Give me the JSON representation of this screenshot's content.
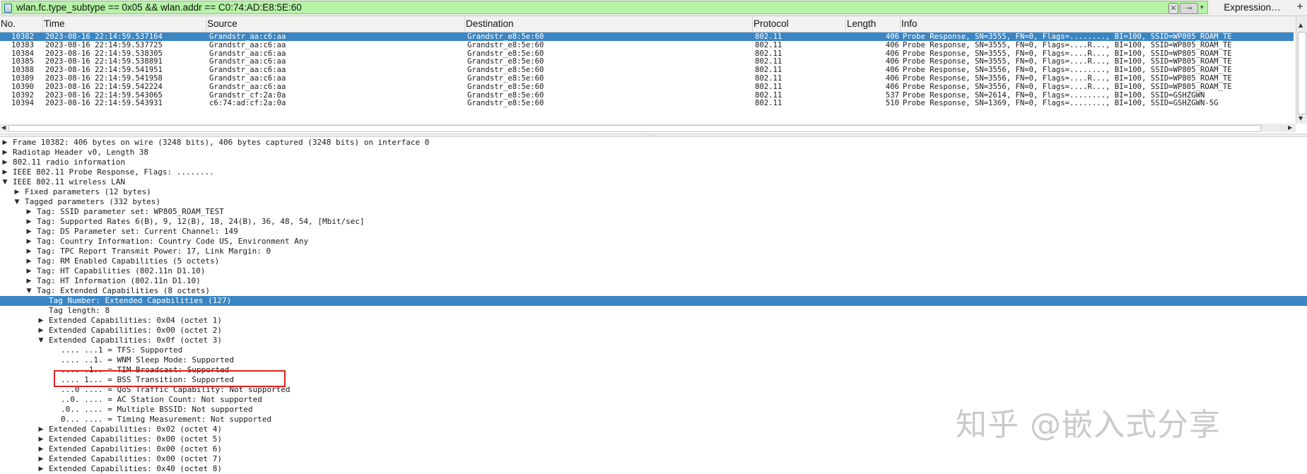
{
  "filter": {
    "expression": "wlan.fc.type_subtype == 0x05 && wlan.addr == C0:74:AD:E8:5E:60",
    "expression_button": "Expression…",
    "add_button": "+",
    "clear_glyph": "✕",
    "apply_glyph": "→",
    "history_glyph": "▾"
  },
  "packet_list": {
    "columns": [
      "No.",
      "Time",
      "Source",
      "Destination",
      "Protocol",
      "Length",
      "Info"
    ],
    "selected_color": "#3a86c4",
    "rows": [
      {
        "no": "10382",
        "time": "2023-08-16 22:14:59.537164",
        "source": "Grandstr_aa:c6:aa",
        "destination": "Grandstr_e8:5e:60",
        "protocol": "802.11",
        "length": "406",
        "info": "Probe Response, SN=3555, FN=0, Flags=........, BI=100, SSID=WP805_ROAM_TE"
      },
      {
        "no": "10383",
        "time": "2023-08-16 22:14:59.537725",
        "source": "Grandstr_aa:c6:aa",
        "destination": "Grandstr_e8:5e:60",
        "protocol": "802.11",
        "length": "406",
        "info": "Probe Response, SN=3555, FN=0, Flags=....R..., BI=100, SSID=WP805_ROAM_TE"
      },
      {
        "no": "10384",
        "time": "2023-08-16 22:14:59.538305",
        "source": "Grandstr_aa:c6:aa",
        "destination": "Grandstr_e8:5e:60",
        "protocol": "802.11",
        "length": "406",
        "info": "Probe Response, SN=3555, FN=0, Flags=....R..., BI=100, SSID=WP805_ROAM_TE"
      },
      {
        "no": "10385",
        "time": "2023-08-16 22:14:59.538891",
        "source": "Grandstr_aa:c6:aa",
        "destination": "Grandstr_e8:5e:60",
        "protocol": "802.11",
        "length": "406",
        "info": "Probe Response, SN=3555, FN=0, Flags=....R..., BI=100, SSID=WP805_ROAM_TE"
      },
      {
        "no": "10388",
        "time": "2023-08-16 22:14:59.541951",
        "source": "Grandstr_aa:c6:aa",
        "destination": "Grandstr_e8:5e:60",
        "protocol": "802.11",
        "length": "406",
        "info": "Probe Response, SN=3556, FN=0, Flags=........, BI=100, SSID=WP805_ROAM_TE"
      },
      {
        "no": "10389",
        "time": "2023-08-16 22:14:59.541958",
        "source": "Grandstr_aa:c6:aa",
        "destination": "Grandstr_e8:5e:60",
        "protocol": "802.11",
        "length": "406",
        "info": "Probe Response, SN=3556, FN=0, Flags=....R..., BI=100, SSID=WP805_ROAM_TE"
      },
      {
        "no": "10390",
        "time": "2023-08-16 22:14:59.542224",
        "source": "Grandstr_aa:c6:aa",
        "destination": "Grandstr_e8:5e:60",
        "protocol": "802.11",
        "length": "406",
        "info": "Probe Response, SN=3556, FN=0, Flags=....R..., BI=100, SSID=WP805_ROAM_TE"
      },
      {
        "no": "10392",
        "time": "2023-08-16 22:14:59.543065",
        "source": "Grandstr_cf:2a:0a",
        "destination": "Grandstr_e8:5e:60",
        "protocol": "802.11",
        "length": "537",
        "info": "Probe Response, SN=2614, FN=0, Flags=........, BI=100, SSID=GSHZGWN"
      },
      {
        "no": "10394",
        "time": "2023-08-16 22:14:59.543931",
        "source": "c6:74:ad:cf:2a:0a",
        "destination": "Grandstr_e8:5e:60",
        "protocol": "802.11",
        "length": "510",
        "info": "Probe Response, SN=1369, FN=0, Flags=........, BI=100, SSID=GSHZGWN-5G"
      }
    ]
  },
  "details": {
    "rows": [
      {
        "level": 0,
        "expander": "collapsed",
        "text": "Frame 10382: 406 bytes on wire (3248 bits), 406 bytes captured (3248 bits) on interface 0"
      },
      {
        "level": 0,
        "expander": "collapsed",
        "text": "Radiotap Header v0, Length 38"
      },
      {
        "level": 0,
        "expander": "collapsed",
        "text": "802.11 radio information"
      },
      {
        "level": 0,
        "expander": "collapsed",
        "text": "IEEE 802.11 Probe Response, Flags: ........"
      },
      {
        "level": 0,
        "expander": "expanded",
        "text": "IEEE 802.11 wireless LAN"
      },
      {
        "level": 1,
        "expander": "collapsed",
        "text": "Fixed parameters (12 bytes)"
      },
      {
        "level": 1,
        "expander": "expanded",
        "text": "Tagged parameters (332 bytes)"
      },
      {
        "level": 2,
        "expander": "collapsed",
        "text": "Tag: SSID parameter set: WP805_ROAM_TEST"
      },
      {
        "level": 2,
        "expander": "collapsed",
        "text": "Tag: Supported Rates 6(B), 9, 12(B), 18, 24(B), 36, 48, 54, [Mbit/sec]"
      },
      {
        "level": 2,
        "expander": "collapsed",
        "text": "Tag: DS Parameter set: Current Channel: 149"
      },
      {
        "level": 2,
        "expander": "collapsed",
        "text": "Tag: Country Information: Country Code US, Environment Any"
      },
      {
        "level": 2,
        "expander": "collapsed",
        "text": "Tag: TPC Report Transmit Power: 17, Link Margin: 0"
      },
      {
        "level": 2,
        "expander": "collapsed",
        "text": "Tag: RM Enabled Capabilities (5 octets)"
      },
      {
        "level": 2,
        "expander": "collapsed",
        "text": "Tag: HT Capabilities (802.11n D1.10)"
      },
      {
        "level": 2,
        "expander": "collapsed",
        "text": "Tag: HT Information (802.11n D1.10)"
      },
      {
        "level": 2,
        "expander": "expanded",
        "text": "Tag: Extended Capabilities (8 octets)"
      },
      {
        "level": 3,
        "expander": "none",
        "text": "Tag Number: Extended Capabilities (127)",
        "selected": true
      },
      {
        "level": 3,
        "expander": "none",
        "text": "Tag length: 8"
      },
      {
        "level": 3,
        "expander": "collapsed",
        "text": "Extended Capabilities: 0x04 (octet 1)"
      },
      {
        "level": 3,
        "expander": "collapsed",
        "text": "Extended Capabilities: 0x00 (octet 2)"
      },
      {
        "level": 3,
        "expander": "expanded",
        "text": "Extended Capabilities: 0x0f (octet 3)"
      },
      {
        "level": 4,
        "expander": "none",
        "text": ".... ...1 = TFS: Supported"
      },
      {
        "level": 4,
        "expander": "none",
        "text": ".... ..1. = WNM Sleep Mode: Supported"
      },
      {
        "level": 4,
        "expander": "none",
        "text": ".... .1.. = TIM Broadcast: Supported"
      },
      {
        "level": 4,
        "expander": "none",
        "text": ".... 1... = BSS Transition: Supported",
        "highlighted": true
      },
      {
        "level": 4,
        "expander": "none",
        "text": "...0 .... = QoS Traffic Capability: Not supported"
      },
      {
        "level": 4,
        "expander": "none",
        "text": "..0. .... = AC Station Count: Not supported"
      },
      {
        "level": 4,
        "expander": "none",
        "text": ".0.. .... = Multiple BSSID: Not supported"
      },
      {
        "level": 4,
        "expander": "none",
        "text": "0... .... = Timing Measurement: Not supported"
      },
      {
        "level": 3,
        "expander": "collapsed",
        "text": "Extended Capabilities: 0x02 (octet 4)"
      },
      {
        "level": 3,
        "expander": "collapsed",
        "text": "Extended Capabilities: 0x00 (octet 5)"
      },
      {
        "level": 3,
        "expander": "collapsed",
        "text": "Extended Capabilities: 0x00 (octet 6)"
      },
      {
        "level": 3,
        "expander": "collapsed",
        "text": "Extended Capabilities: 0x00 (octet 7)"
      },
      {
        "level": 3,
        "expander": "collapsed",
        "text": "Extended Capabilities: 0x40 (octet 8)"
      }
    ]
  },
  "annotation": {
    "color": "#e02020"
  },
  "watermark": {
    "text": "知乎 @嵌入式分享"
  }
}
